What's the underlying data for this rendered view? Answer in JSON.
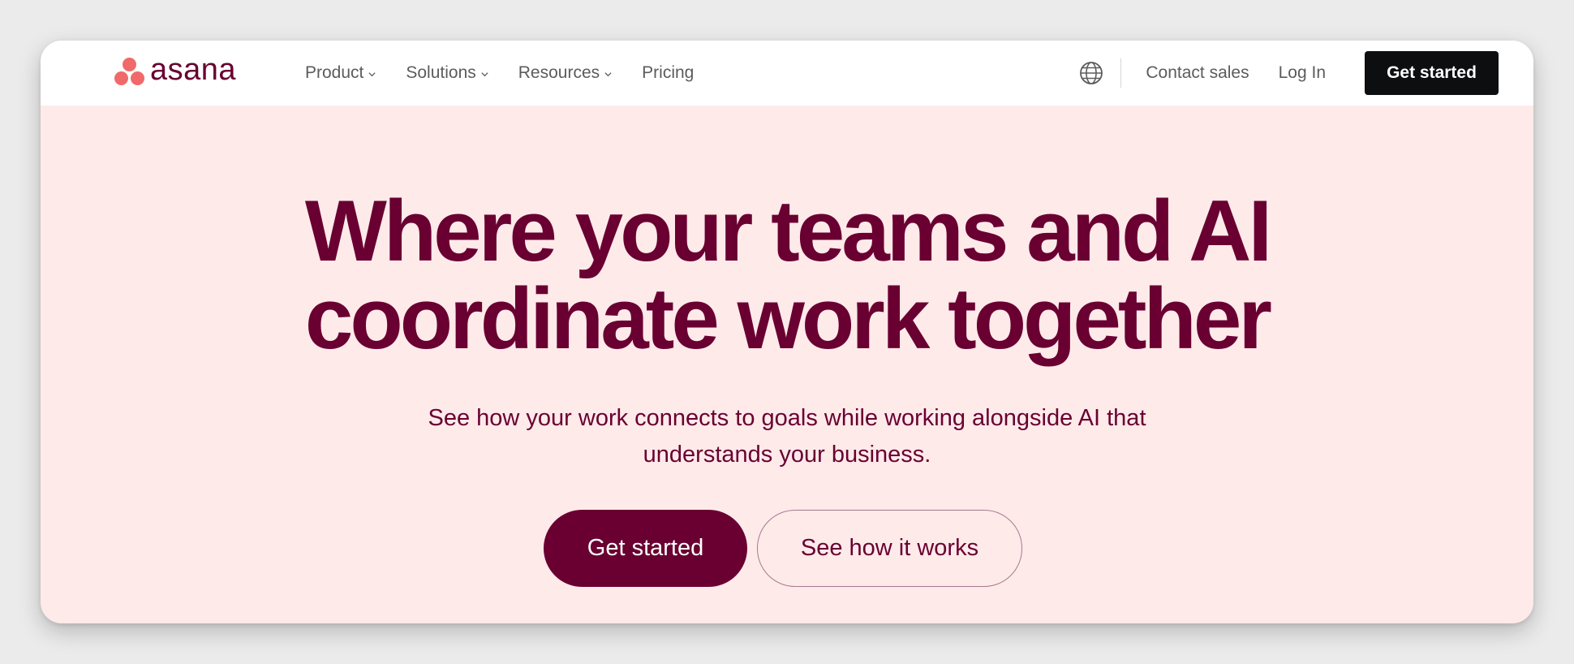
{
  "colors": {
    "brand_plum": "#690031",
    "brand_coral": "#f06a6a",
    "hero_background": "#ffeaea",
    "top_button_bg": "#0d0e10",
    "nav_text": "#5c5c5c"
  },
  "nav": {
    "logo_text": "asana",
    "items": [
      {
        "label": "Product",
        "has_dropdown": true
      },
      {
        "label": "Solutions",
        "has_dropdown": true
      },
      {
        "label": "Resources",
        "has_dropdown": true
      },
      {
        "label": "Pricing",
        "has_dropdown": false
      }
    ],
    "language_icon": "globe-icon",
    "contact_sales": "Contact sales",
    "login": "Log In",
    "get_started": "Get started"
  },
  "hero": {
    "headline_line1": "Where your teams and AI",
    "headline_line2": "coordinate work together",
    "subhead_line1": "See how your work connects to goals while working alongside AI that",
    "subhead_line2": "understands your business.",
    "primary_cta": "Get started",
    "secondary_cta": "See how it works"
  }
}
